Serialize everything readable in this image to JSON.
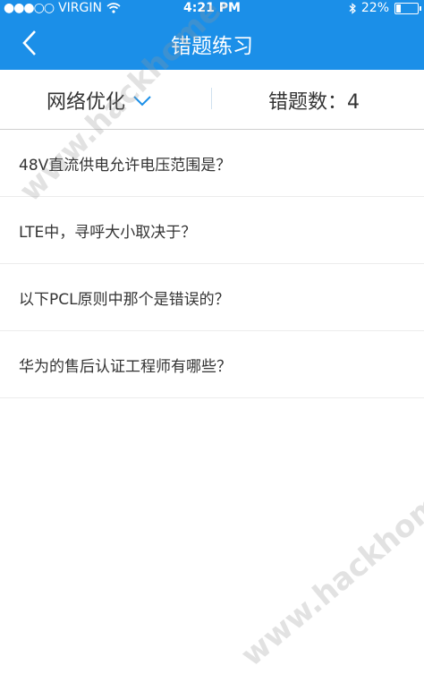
{
  "status_bar": {
    "carrier": "VIRGIN",
    "time": "4:21 PM",
    "battery": "22%",
    "battery_level": 0.22
  },
  "navbar": {
    "title": "错题练习"
  },
  "filter": {
    "category": "网络优化",
    "count_label": "错题数：4"
  },
  "questions": [
    {
      "text": "48V直流供电允许电压范围是？"
    },
    {
      "text": "LTE中，寻呼大小取决于？"
    },
    {
      "text": "以下PCL原则中那个是错误的？"
    },
    {
      "text": "华为的售后认证工程师有哪些？"
    }
  ],
  "watermark": {
    "text": "www.hackhome.com"
  },
  "colors": {
    "accent": "#1b8fe8"
  }
}
